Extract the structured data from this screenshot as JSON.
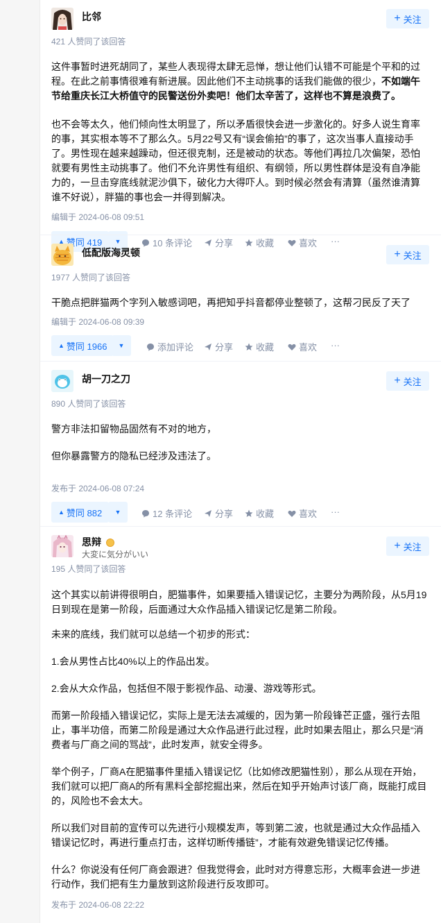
{
  "answers": [
    {
      "author": "比邻",
      "follow_label": "关注",
      "votes_line": "421 人赞同了该回答",
      "para1_a": "这件事暂时进死胡同了，某些人表现得太肆无忌惮，想让他们认错不可能是个平和的过程。在此之前事情很难有新进展。因此他们不主动挑事的话我们能做的很少，",
      "para1_b": "不如端午节给重庆长江大桥值守的民警送份外卖吧！他们太辛苦了，这样也不算是浪费了。",
      "para2_a": "也不会等太久，他们倾向性太明显了，所以矛盾很快会进一步激化的。好多人说生育率的事，其实根本等不了那么久。5月22号又有“误会偷拍”的事了，这次当事人直接动手了。男性现在越来越躁动，但还很克制，还是被动的状态。等他们再拉几次偏架，恐怕就要有男性主动挑事了。他们不允许男性有组织、有纲领，所以男性群体是没有自净能力的，一旦击穿底线就泥沙俱下，破化力大得吓人。到时候必然会有清算（虽然谁清算谁不好说），胖猫的事也会一并得到解决。",
      "edited": "编辑于 2024-06-08 09:51",
      "vote_label": "赞同 419",
      "comments": "10 条评论",
      "share": "分享",
      "collect": "收藏",
      "like": "喜欢",
      "more": "···"
    },
    {
      "author": "低配版海灵顿",
      "follow_label": "关注",
      "votes_line": "1977 人赞同了该回答",
      "para1": "干脆点把胖猫两个字列入敏感词吧，再把知乎抖音都停业整顿了，这帮刁民反了天了",
      "edited": "编辑于 2024-06-08 09:39",
      "vote_label": "赞同 1966",
      "comments": "添加评论",
      "share": "分享",
      "collect": "收藏",
      "like": "喜欢",
      "more": "···"
    },
    {
      "author": "胡一刀之刀",
      "follow_label": "关注",
      "votes_line": "890 人赞同了该回答",
      "para1": "警方非法扣留物品固然有不对的地方，",
      "para2": "但你暴露警方的隐私已经涉及违法了。",
      "edited": "发布于 2024-06-08 07:24",
      "vote_label": "赞同 882",
      "comments": "12 条评论",
      "share": "分享",
      "collect": "收藏",
      "like": "喜欢",
      "more": "···"
    },
    {
      "author": "思辩",
      "headline": "大変に気分がいい",
      "follow_label": "关注",
      "votes_line": "195 人赞同了该回答",
      "paras": [
        "这个其实以前讲得很明白，肥猫事件，如果要插入错误记忆，主要分为两阶段，从5月19日到现在是第一阶段，后面通过大众作品插入错误记忆是第二阶段。",
        "未来的底线，我们就可以总结一个初步的形式：",
        "1.会从男性占比40%以上的作品出发。",
        "2.会从大众作品，包括但不限于影视作品、动漫、游戏等形式。",
        "而第一阶段插入错误记忆，实际上是无法去减缓的，因为第一阶段锋芒正盛，强行去阻止，事半功倍，而第二阶段是通过大众作品进行此过程，此时如果去阻止，那么只是“消费者与厂商之间的骂战”，此时发声，就安全得多。",
        "举个例子，厂商A在肥猫事件里插入错误记忆（比如修改肥猫性别），那么从现在开始，我们就可以把厂商A的所有黑料全部挖掘出来，然后在知乎开始声讨该厂商，既能打成目的，风险也不会太大。",
        "所以我们对目前的宣传可以先进行小规模发声，等到第二波，也就是通过大众作品插入错误记忆时，再进行重点打击，这样切断传播链”，才能有效避免错误记忆传播。",
        "什么？你说没有任何厂商会跟进？但我觉得会，此时对方得意忘形，大概率会进一步进行动作，我们把有生力量放到这阶段进行反攻即可。"
      ],
      "edited": "发布于 2024-06-08 22:22"
    }
  ]
}
